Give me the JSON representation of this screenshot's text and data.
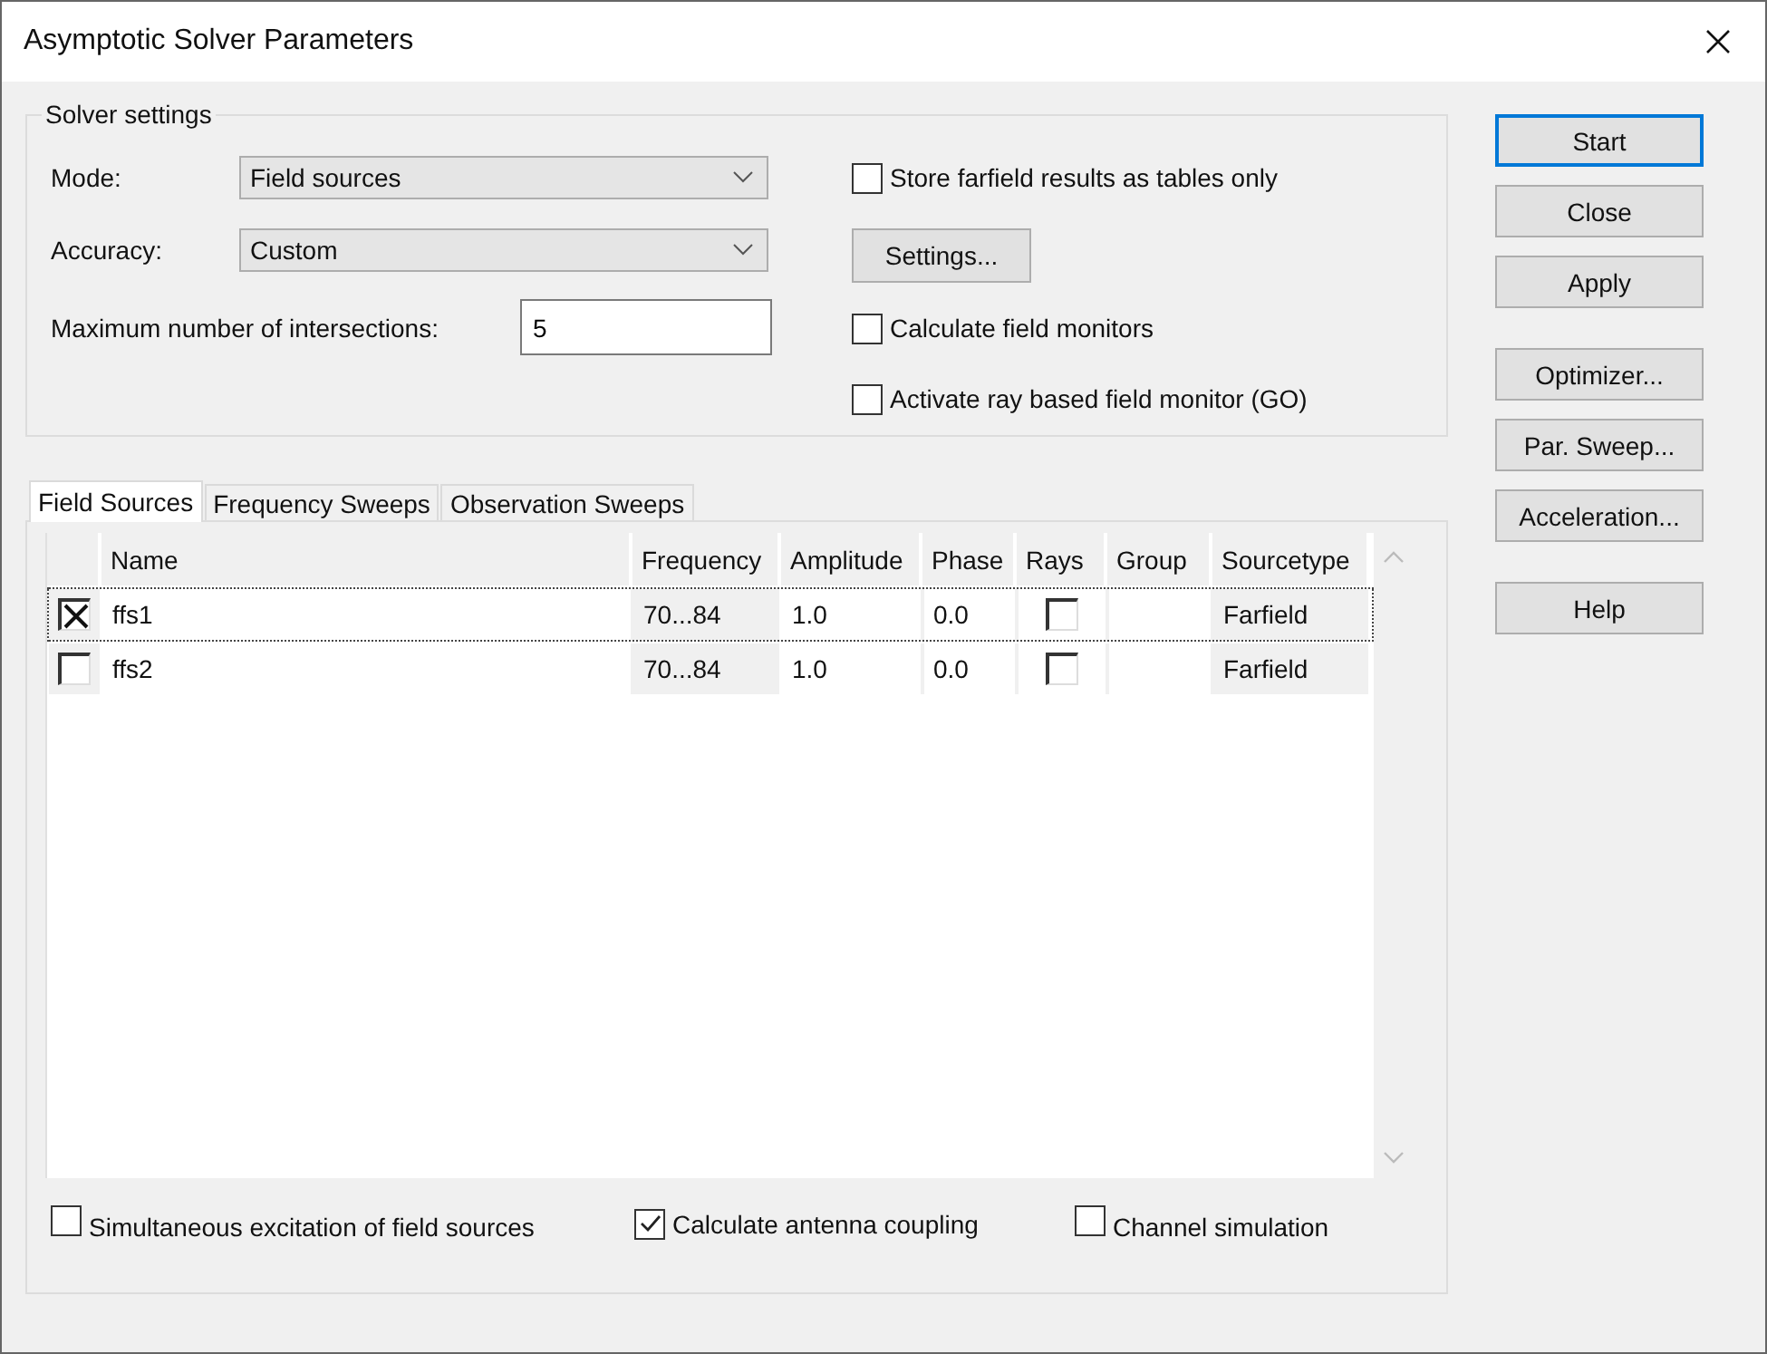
{
  "window": {
    "title": "Asymptotic Solver Parameters"
  },
  "solver_settings": {
    "title": "Solver settings",
    "fields": [
      {
        "kind": "combo",
        "label": "Mode:",
        "value": "Field sources"
      },
      {
        "kind": "combo",
        "label": "Accuracy:",
        "value": "Custom"
      },
      {
        "kind": "input",
        "label": "Maximum number of intersections:",
        "value": "5"
      }
    ],
    "options": [
      {
        "kind": "checkbox",
        "label": "Store farfield results as tables only",
        "checked": false
      },
      {
        "kind": "button",
        "label": "Settings..."
      },
      {
        "kind": "checkbox",
        "label": "Calculate field monitors",
        "checked": false
      },
      {
        "kind": "checkbox",
        "label": "Activate ray based field monitor (GO)",
        "checked": false
      }
    ]
  },
  "tabs": [
    {
      "label": "Field Sources",
      "selected": true
    },
    {
      "label": "Frequency Sweeps",
      "selected": false
    },
    {
      "label": "Observation Sweeps",
      "selected": false
    }
  ],
  "table": {
    "columns": [
      "Name",
      "Frequency",
      "Amplitude",
      "Phase",
      "Rays",
      "Group",
      "Sourcetype"
    ],
    "rows": [
      {
        "selected": true,
        "enabled": true,
        "name": "ffs1",
        "frequency": "70...84",
        "amplitude": "1.0",
        "phase": "0.0",
        "rays": false,
        "sourcetype": "Farfield"
      },
      {
        "selected": false,
        "enabled": false,
        "name": "ffs2",
        "frequency": "70...84",
        "amplitude": "1.0",
        "phase": "0.0",
        "rays": false,
        "sourcetype": "Farfield"
      }
    ]
  },
  "bottom_options": [
    {
      "label": "Simultaneous excitation of field sources",
      "checked": false
    },
    {
      "label": "Calculate antenna coupling",
      "checked": true
    },
    {
      "label": "Channel simulation",
      "checked": false
    }
  ],
  "button_groups": [
    [
      {
        "label": "Start",
        "default": true
      },
      {
        "label": "Close",
        "default": false
      },
      {
        "label": "Apply",
        "default": false
      }
    ],
    [
      {
        "label": "Optimizer...",
        "default": false
      },
      {
        "label": "Par. Sweep...",
        "default": false
      },
      {
        "label": "Acceleration...",
        "default": false
      }
    ],
    [
      {
        "label": "Help",
        "default": false
      }
    ]
  ]
}
